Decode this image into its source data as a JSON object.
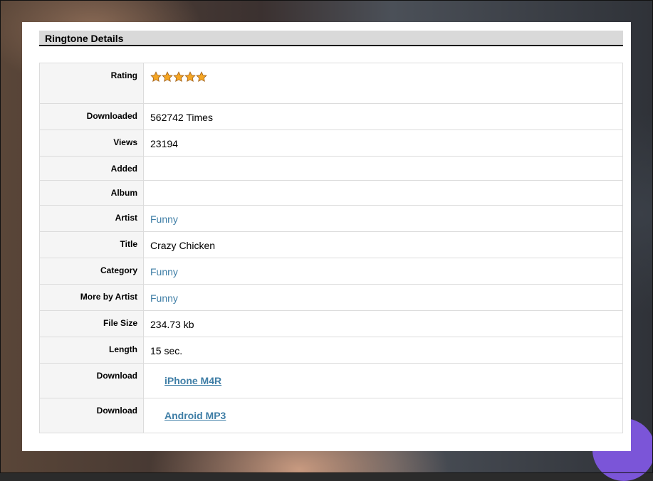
{
  "section_title": "Ringtone Details",
  "rating": {
    "label": "Rating",
    "stars_filled": 5,
    "stars_total": 5,
    "star_color": "#f5a623"
  },
  "rows": {
    "downloaded": {
      "label": "Downloaded",
      "value": "562742 Times"
    },
    "views": {
      "label": "Views",
      "value": "23194"
    },
    "added": {
      "label": "Added",
      "value": ""
    },
    "album": {
      "label": "Album",
      "value": ""
    },
    "artist": {
      "label": "Artist",
      "value": "Funny"
    },
    "title": {
      "label": "Title",
      "value": "Crazy Chicken"
    },
    "category": {
      "label": "Category",
      "value": "Funny"
    },
    "more_by_artist": {
      "label": "More by Artist",
      "value": "Funny"
    },
    "file_size": {
      "label": "File Size",
      "value": "234.73 kb"
    },
    "length": {
      "label": "Length",
      "value": "15 sec."
    },
    "download_iphone": {
      "label": "Download",
      "value": "iPhone M4R"
    },
    "download_android": {
      "label": "Download",
      "value": "Android MP3"
    }
  },
  "colors": {
    "link": "#3f7ea6",
    "header_bg": "#d9d9d9",
    "label_bg": "#f5f5f5"
  }
}
